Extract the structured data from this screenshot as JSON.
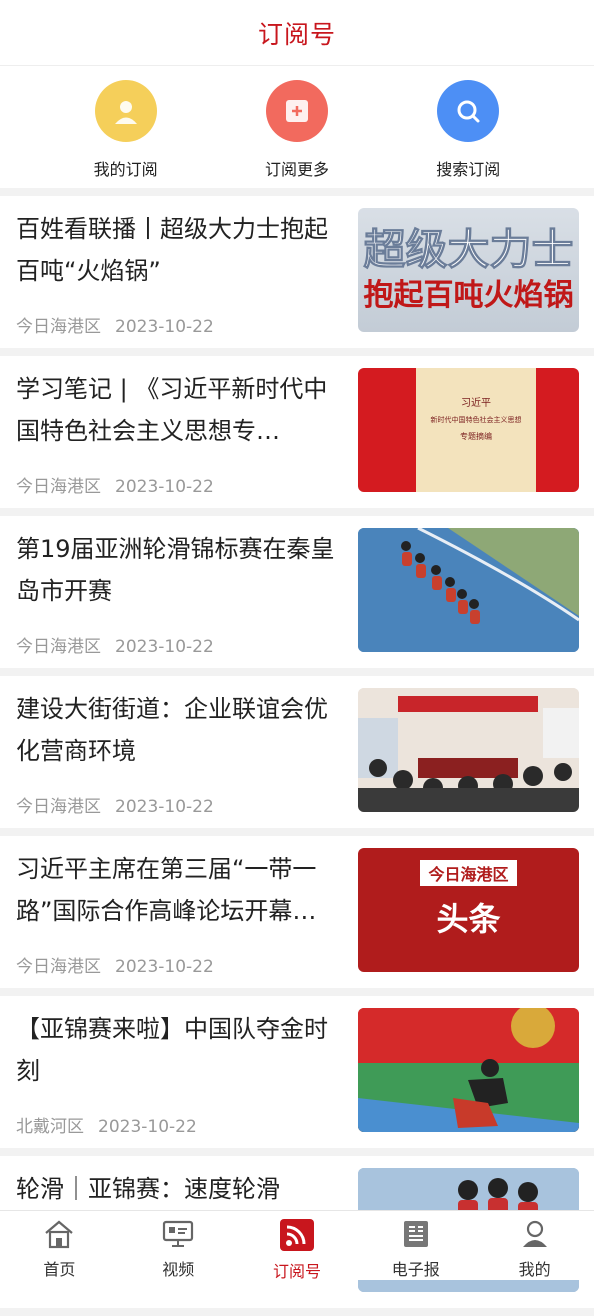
{
  "header": {
    "title": "订阅号"
  },
  "quick_actions": [
    {
      "label": "我的订阅",
      "icon": "person-icon",
      "color": "#f5cf5a"
    },
    {
      "label": "订阅更多",
      "icon": "add-icon",
      "color": "#f26a5e"
    },
    {
      "label": "搜索订阅",
      "icon": "search-icon",
      "color": "#4d8ff5"
    }
  ],
  "articles": [
    {
      "title": "百姓看联播丨超级大力士抱起百吨“火焰锅”",
      "source": "今日海港区",
      "date": "2023-10-22",
      "thumb_text1": "超级大力士",
      "thumb_text2": "抱起百吨火焰锅"
    },
    {
      "title": "学习笔记 | 《习近平新时代中国特色社会主义思想专…",
      "source": "今日海港区",
      "date": "2023-10-22",
      "thumb_text1": "习近平",
      "thumb_text2": "新时代中国特色社会主义思想",
      "thumb_text3": "专题摘编"
    },
    {
      "title": "第19届亚洲轮滑锦标赛在秦皇岛市开赛",
      "source": "今日海港区",
      "date": "2023-10-22"
    },
    {
      "title": "建设大街街道：企业联谊会优化营商环境",
      "source": "今日海港区",
      "date": "2023-10-22"
    },
    {
      "title": "习近平主席在第三届“一带一路”国际合作高峰论坛开幕…",
      "source": "今日海港区",
      "date": "2023-10-22",
      "thumb_text1": "今日海港区",
      "thumb_text2": "头条"
    },
    {
      "title": "【亚锦赛来啦】中国队夺金时刻",
      "source": "北戴河区",
      "date": "2023-10-22"
    },
    {
      "title": "轮滑｜亚锦赛：速度轮滑",
      "source": "",
      "date": ""
    }
  ],
  "tabbar": [
    {
      "label": "首页",
      "icon": "home-icon"
    },
    {
      "label": "视频",
      "icon": "video-icon"
    },
    {
      "label": "订阅号",
      "icon": "rss-icon"
    },
    {
      "label": "电子报",
      "icon": "newspaper-icon"
    },
    {
      "label": "我的",
      "icon": "profile-icon"
    }
  ],
  "colors": {
    "accent": "#c8161d",
    "background": "#f2f2f2"
  }
}
